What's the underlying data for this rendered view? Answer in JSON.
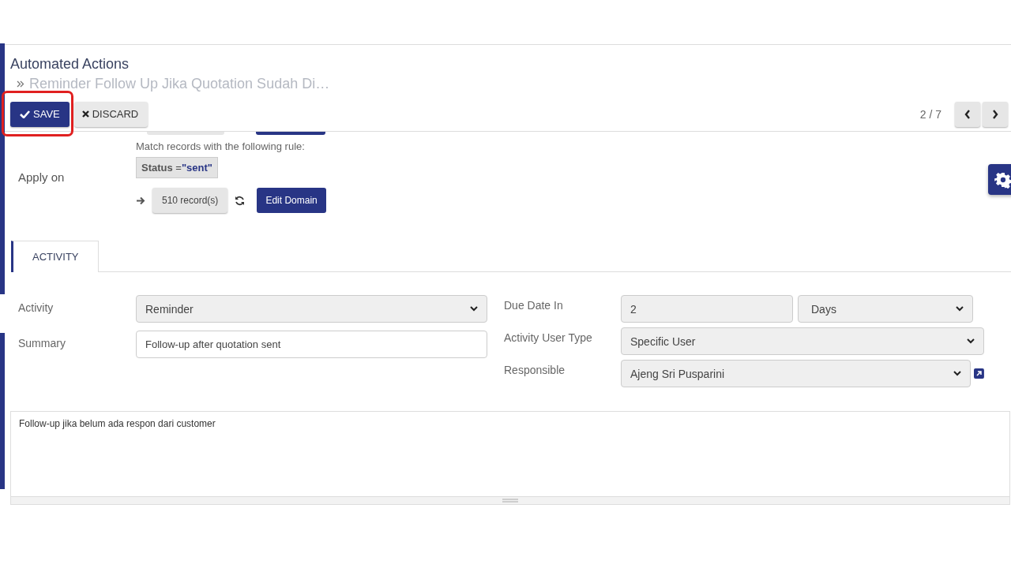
{
  "breadcrumb": {
    "title": "Automated Actions",
    "record": "Reminder Follow Up Jika Quotation Sudah Di…"
  },
  "buttons": [
    {
      "kind": "primary",
      "label": "SAVE",
      "highlighted": true
    },
    {
      "kind": "secondary",
      "label": "DISCARD"
    }
  ],
  "pager": {
    "counter": "2 / 7"
  },
  "apply_on": {
    "label": "Apply on",
    "caption": "Match records with the following rule:",
    "condition": {
      "field": "Status",
      "operator": "=",
      "value": "\"sent\""
    },
    "record_count": "510 record(s)",
    "edit_button": "Edit Domain"
  },
  "tabs": [
    {
      "label": "ACTIVITY",
      "selected": true
    }
  ],
  "left_fields": [
    {
      "label": "Activity",
      "kind": "select",
      "value": "Reminder"
    },
    {
      "label": "Summary",
      "kind": "input",
      "value": "Follow-up after quotation sent"
    }
  ],
  "right_fields": [
    {
      "label": "Due Date In",
      "kind": "amount",
      "value": "2",
      "unit": "Days"
    },
    {
      "label": "Activity User Type",
      "kind": "select",
      "value": "Specific User"
    },
    {
      "label": "Responsible",
      "kind": "many2one",
      "value": "Ajeng Sri Pusparini"
    }
  ],
  "note": "Follow-up jika belum ada respon dari customer"
}
